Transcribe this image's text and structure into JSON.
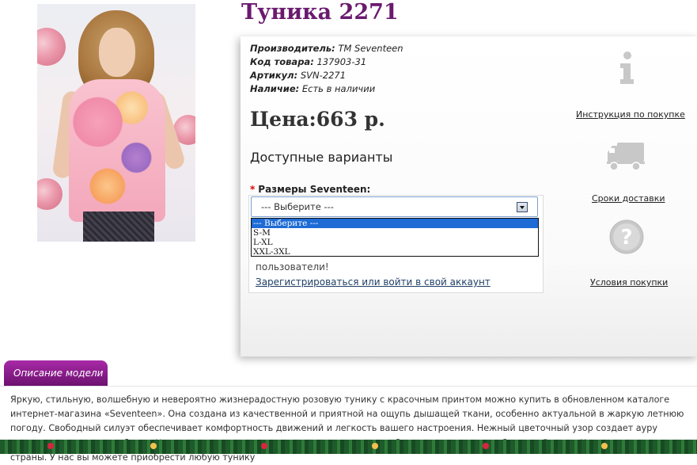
{
  "product": {
    "title": "Туника 2271",
    "meta": [
      {
        "label": "Производитель:",
        "value": "ТМ Seventeen"
      },
      {
        "label": "Код товара:",
        "value": "137903-31"
      },
      {
        "label": "Артикул:",
        "value": "SVN-2271"
      },
      {
        "label": "Наличие:",
        "value": "Есть в наличии"
      }
    ],
    "price": "Цена:663 р.",
    "variants_heading": "Доступные варианты",
    "size_label": "Размеры Seventeen:",
    "required_marker": "*",
    "select": {
      "current": "--- Выберите ---",
      "options": [
        "--- Выберите ---",
        "S-M",
        "L-XL",
        "XXL-3XL"
      ]
    },
    "notice_text": "пользователи!",
    "notice_link": "Зарегистрироваться или войти в свой аккаунт"
  },
  "info_links": [
    {
      "label": "Инструкция по покупке",
      "icon": "info-icon"
    },
    {
      "label": "Сроки доставки",
      "icon": "truck-icon"
    },
    {
      "label": "Условия покупки",
      "icon": "question-icon"
    }
  ],
  "description": {
    "tab_label": "Описание модели",
    "text": "Яркую, стильную, волшебную и невероятно жизнерадостную розовую тунику с красочным принтом можно купить в обновленном каталоге интернет-магазина «Seventeen». Она создана из качественной и приятной на ощупь дышащей ткани, особенно актуальной в жаркую летнюю погоду. Свободный силуэт обеспечивает комфортность движений и легкость вашего настроения. Нежный цветочный узор создает ауру романтичности и волшебства. Нашим восхитительным модницам гарантируется быстрая доставка по областям России, Украины и в другие страны. У нас вы можете приобрести любую тунику"
  },
  "colors": {
    "title": "#6a1a6e",
    "tab": "#8a1f8c",
    "select_highlight": "#1e6bd6",
    "required": "#dd0000"
  }
}
